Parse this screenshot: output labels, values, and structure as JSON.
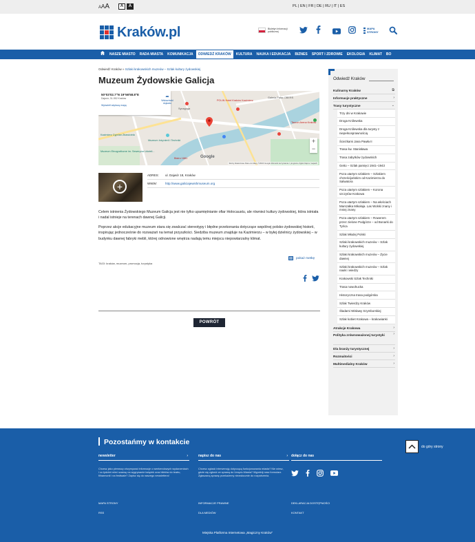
{
  "topbar": {
    "font_sizes": [
      "A",
      "A",
      "A"
    ],
    "contrast_normal": "A",
    "contrast_high": "A",
    "languages": "PL | EN | FR | DE | RU | IT | ES"
  },
  "header": {
    "brand": "Kraków.pl",
    "bip_label": "Biuletyn Informacji publicznej",
    "map_label_line1": "MAPA",
    "map_label_line2": "STRONY",
    "search_icon": "search-icon"
  },
  "nav": {
    "items": [
      "NASZE MIASTO",
      "RADA MIASTA",
      "KOMUNIKACJA",
      "ODWIEDŹ KRAKÓW",
      "KULTURA",
      "NAUKA I EDUKACJA",
      "BIZNES",
      "SPORT I ZDROWIE",
      "EKOLOGIA",
      "KLIMAT",
      "BO"
    ],
    "active_index": 3
  },
  "breadcrumb": {
    "first": "Odwiedź Kraków",
    "sep": " » ",
    "second": "Szlaki krakowskich muzeów – Szlak kultury żydowskiej"
  },
  "page": {
    "title": "Muzeum Żydowskie Galicja"
  },
  "map": {
    "coords": "50°03'02.7\"N 19°56'58.8\"E",
    "address": "Dajwór, 31-052 Kraków",
    "directions": "Wskazówki dojazdu",
    "bigger_map": "Wyświetl większą mapę",
    "google": "Google",
    "terms": "Skróty klawiszowe   Dane do Mapy ©2024 Google   Warunki korzystania z programu   Zgłoś błąd w mapach",
    "zoom_in": "+",
    "zoom_out": "−",
    "labels": {
      "polin": "POLIN Hotel Kraków Kazimierz",
      "kazimierz": "Kazimierz Cyprian Zbawiciela",
      "ethno": "Muzeum Etnograficzne im. Seweryna Udzieli...",
      "engineering": "Muzeum Inżynierii i Techniki",
      "bistro": "Bistro 1881",
      "galeria": "Galeria Pałac OBERS",
      "tauron": "Tauron Arena Kraków",
      "synagogue": "Synagoga"
    }
  },
  "details": {
    "address_label": "ADRES:",
    "address_value": "ul. Dajwór 18, Kraków",
    "www_label": "WWW:",
    "www_value": "http://www.galiciajewishmuseum.org"
  },
  "content": {
    "p1": "Celem istnienia Żydowskiego Muzeum Galicja jest nie tylko upamiętnianie ofiar Holocaustu, ale również kultury żydowskiej, która istniała i nadal istnieje na terenach dawnej Galicji.",
    "p2": "Poprzez akcje edukacyjne muzeum stara się zwalczać stereotypy i błędne przekonania dotyczące wspólnej polsko-żydowskiej historii, inspirując jednocześnie do rozważań na temat przyszłości. Siedziba muzeum znajduje na Kazimierzu – w byłej dzielnicy żydowskiej – w budynku dawnej fabryki mebli, której odnowione wnętrza nadają temu miejscu niepowtarzalny klimat.",
    "show_map": "pokaż metkę",
    "tags": "TAGI: kraków, muzeum, promocja, turystyka",
    "back": "POWRÓT"
  },
  "sidebar": {
    "heading": "Odwiedź Kraków",
    "top_items": [
      {
        "label": "Kulinarny Kraków",
        "arrow": "⧉"
      },
      {
        "label": "Informacje praktyczne",
        "arrow": "›"
      },
      {
        "label": "Trasy turystyczne",
        "arrow": "⌄"
      }
    ],
    "sub_items": [
      "Trzy dni w Krakowie",
      "Droga Królewska",
      "Droga Królewska dla turysty z niepełnosprawnością",
      "Ścieżkami Jana Pawła II",
      "Trasa św. Stanisława",
      "Trasa zabytków żydowskich",
      "Getto – Szlak pamięci 1941–1943",
      "Poza utartym szlakiem – Szlakiem chrześcijańskim od Kazimierza do Salwatora",
      "Poza utartym szlakiem – Korona szczytów Krakowa",
      "Poza utartym szlakiem – Na włościach Marszałka Mikołaja. Las Wolski znany i mniej znany",
      "Poza utartym szlakiem – Rowerem przez zielone Podgórze – od Bonarki do Tyńca",
      "Szlak Młodej Polski",
      "Szlaki krakowskich muzeów – Szlak kultury żydowskiej",
      "Szlaki krakowskich muzeów – Życie dawnej",
      "Szlaki krakowskich muzeów – Szlak nauki i wiedzy",
      "Krakowski Szlak Techniki",
      "Trasa nowohucka",
      "Historyczna trasa podgórska",
      "Szlak Twierdzy Kraków",
      "Śladami Wisławy Szymborskiej",
      "Szlak kobiet Krakowa – krakowianki"
    ],
    "bottom_items": [
      {
        "label": "Atrakcje Krakowa",
        "arrow": "›"
      },
      {
        "label": "Polityka zrównoważonej turystyki",
        "arrow": "›"
      },
      {
        "label": "Dla branży turystycznej",
        "arrow": "›"
      },
      {
        "label": "Rozmaitości",
        "arrow": "›"
      },
      {
        "label": "Multimedialny Kraków",
        "arrow": "›"
      }
    ]
  },
  "footer": {
    "heading": "Pozostańmy w kontakcie",
    "newsletter_title": "newsletter",
    "newsletter_text": "Chcesz jako pierwszy otrzymywać informacje o weekendowych wydarzeniach i co tydzień mieć szansę na wygrywanie książek oraz biletów do teatru, filharmonii i na festiwale? Zapisz się do naszego newslettera!",
    "write_title": "napisz do nas",
    "write_text": "Chcesz zgłosić interwencję dotyczącą funkcjonowania miasta? Nie wiesz, gdzie się zgłosić ze sprawą do Urzędu Miasta? Wypełnij nasz formularz. Zgłaszaną sprawę przekażemy niezwłocznie do rozpatrzenia.",
    "join_title": "dołącz do nas",
    "arrow": "›",
    "links": [
      "MAPA STRONY",
      "RSS",
      "INFORMACJE PRAWNE",
      "DLA MEDIÓW",
      "DEKLARACJA DOSTĘPNOŚCI",
      "KONTAKT"
    ],
    "platform": "Miejska Platforma Internetowa „Magiczny Kraków”",
    "to_top": "do góry strony"
  },
  "colors": {
    "brand_blue": "#1a5ea8",
    "button_dark": "#1e2533",
    "sidebar_bg": "#f1f1f1"
  }
}
